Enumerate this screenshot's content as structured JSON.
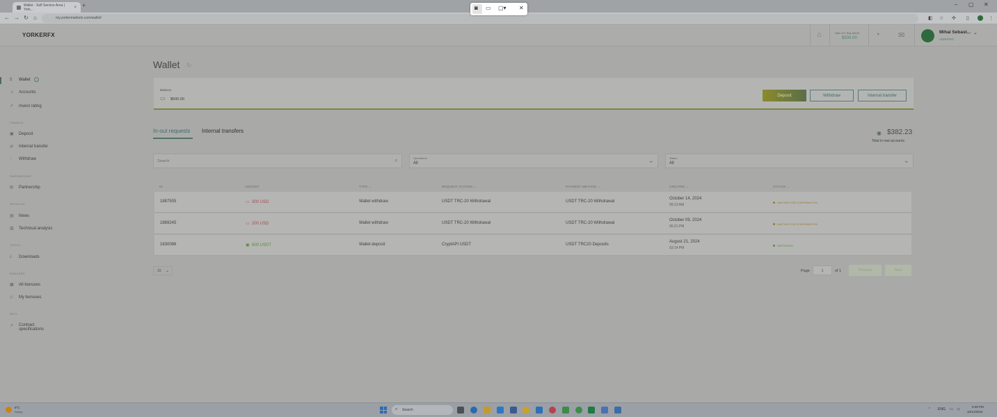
{
  "browser": {
    "tabs": [
      {
        "title": "Wallet - Self Service Area | York...",
        "active": true
      },
      {
        "title": "",
        "active": false
      }
    ],
    "url": "my.yorkermarkets.com/wallet/",
    "new_tab": "+",
    "minimize": "–",
    "restore": "▢",
    "close": "✕"
  },
  "snip": {
    "camera": "◙",
    "video": "▭",
    "rect": "▢▾",
    "close": "✕"
  },
  "header": {
    "logo": "YORKERFX",
    "wallet_balance_label": "WALLET BALANCE",
    "wallet_balance_value": "$500.00",
    "user_name": "Mihai Sebast...",
    "user_status": "VERIFIED",
    "caret": "⌄"
  },
  "sidebar": {
    "wallet": "Wallet",
    "wallet_info": "i",
    "accounts": "Accounts",
    "invest_rating": "Invest rating",
    "sections": {
      "finance": "FINANCE",
      "partnership": "PARTNERSHIP",
      "articles": "ARTICLES",
      "tools": "TOOLS",
      "bonuses": "BONUSES",
      "info": "INFO"
    },
    "deposit": "Deposit",
    "internal_transfer": "Internal transfer",
    "withdraw": "Withdraw",
    "partnership": "Partnership",
    "news": "News",
    "technical_analysis": "Technical analysis",
    "downloads": "Downloads",
    "all_bonuses": "All bonuses",
    "my_bonuses": "My bonuses",
    "contract_specifications": "Contract specifications"
  },
  "main": {
    "title": "Wallet",
    "balance_label": "Balance",
    "balance_value": "$500.00",
    "buttons": {
      "deposit": "Deposit",
      "withdraw": "Withdraw",
      "internal_transfer": "Internal transfer"
    },
    "tabs": {
      "in_out": "In-out requests",
      "internal": "Internal transfers"
    },
    "total_value": "$382.23",
    "total_label": "Total in real accounts",
    "filters": {
      "search_placeholder": "Search",
      "operations_label": "Operations",
      "operations_value": "All",
      "status_label": "Status",
      "status_value": "All"
    },
    "columns": {
      "id": "ID",
      "amount": "AMOUNT",
      "type": "TYPE ⌄",
      "request_system": "REQUEST SYSTEM ⌄",
      "payment_method": "PAYMENT METHOD ⌄",
      "created": "CREATED ⌄",
      "status": "STATUS ⌄"
    },
    "rows": [
      {
        "id": "1887505",
        "amount": "300 USD",
        "type": "Wallet withdraw",
        "system": "USDT TRC-20 Withdrawal",
        "method": "USDT TRC-20 Withdrawal",
        "date": "October 14, 2024",
        "time": "09:13 AM",
        "status": "WAITING FOR CONFIRMATION",
        "status_kind": "wait"
      },
      {
        "id": "1869245",
        "amount": "200 USD",
        "type": "Wallet withdraw",
        "system": "USDT TRC-20 Withdrawal",
        "method": "USDT TRC-20 Withdrawal",
        "date": "October 09, 2024",
        "time": "06:21 PM",
        "status": "WAITING FOR CONFIRMATION",
        "status_kind": "wait"
      },
      {
        "id": "1630086",
        "amount": "600 USDT",
        "type": "Wallet deposit",
        "system": "CryptAPI USDT",
        "method": "USDT TRC20 Deposits",
        "date": "August 21, 2024",
        "time": "03:14 PM",
        "status": "DEPOSITED",
        "status_kind": "ok"
      }
    ],
    "pagination": {
      "per_page": "10",
      "page_label": "Page",
      "page_value": "1",
      "of_label": "of 1",
      "previous": "Previous",
      "next": "Next"
    }
  },
  "taskbar": {
    "weather_temp": "9°C",
    "weather_desc": "Sunny",
    "search": "Search",
    "lang": "ENG",
    "time": "6:39 PM",
    "date": "10/14/2024"
  },
  "colors": {
    "accent_teal": "#3f6a6c",
    "deposit_start": "#8c8a2b",
    "deposit_end": "#5b6d49",
    "negative": "#a5484e",
    "positive": "#5c8a3f",
    "waiting": "#9a7a2e"
  }
}
